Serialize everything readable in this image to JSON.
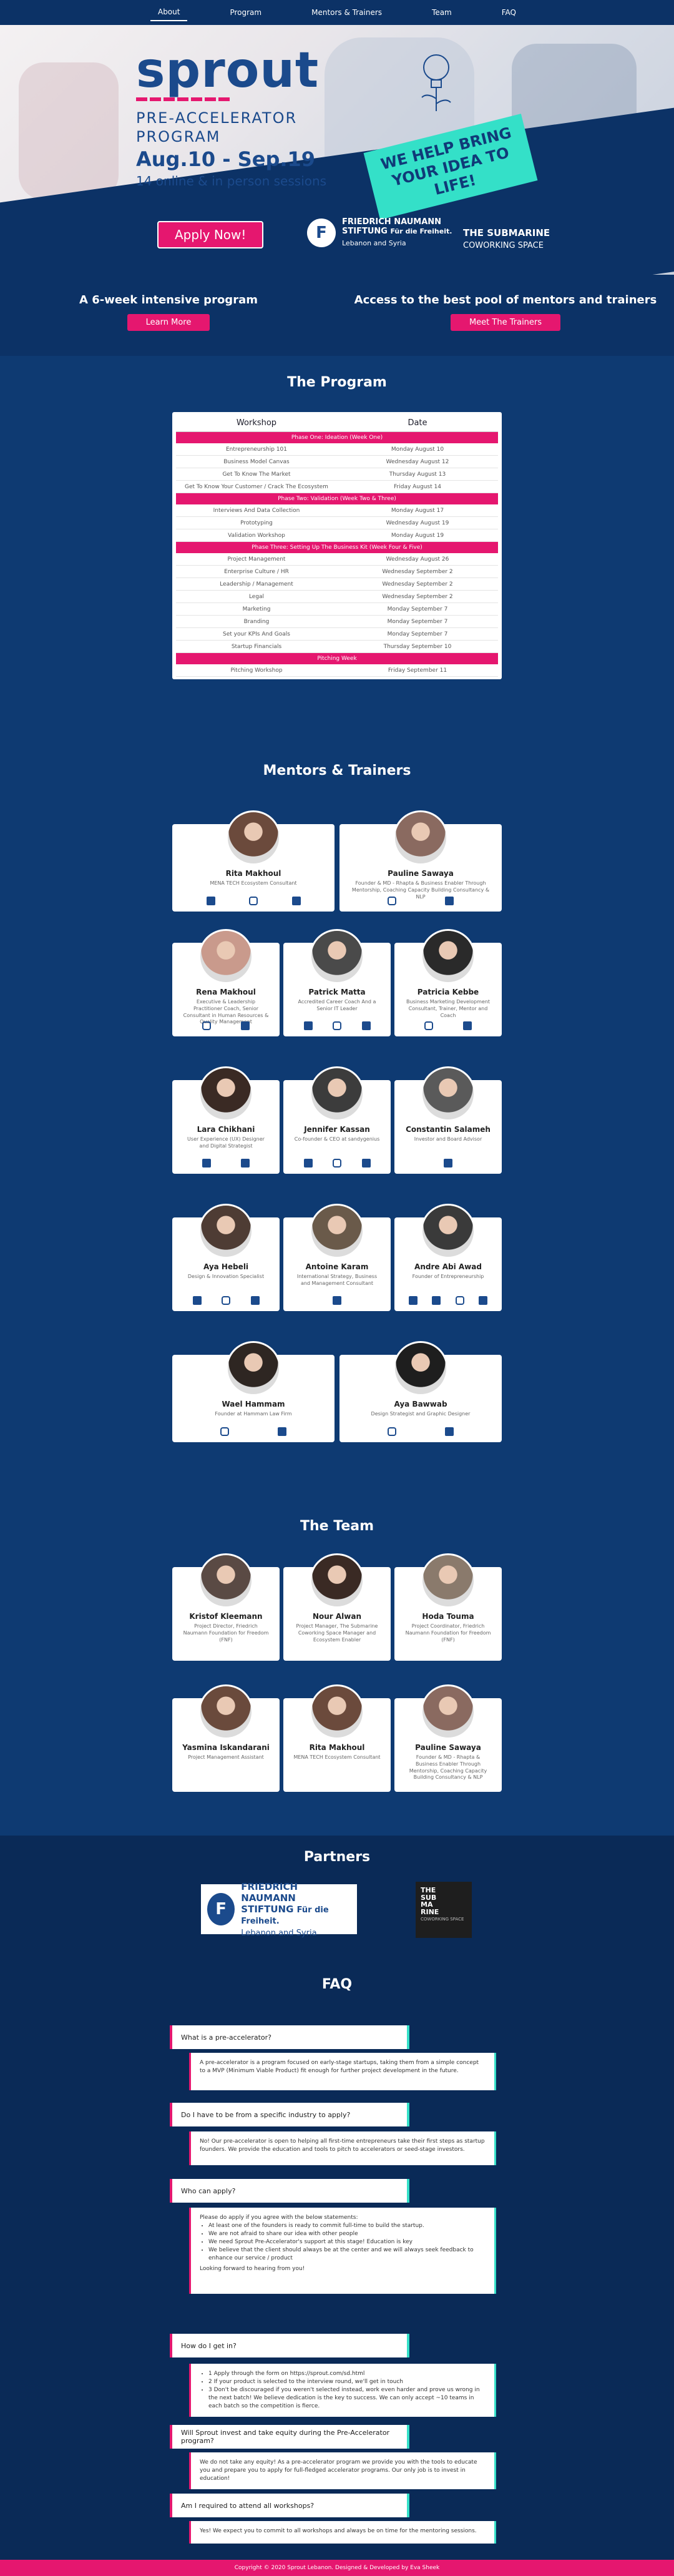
{
  "nav": {
    "items": [
      {
        "label": "About"
      },
      {
        "label": "Program"
      },
      {
        "label": "Mentors & Trainers"
      },
      {
        "label": "Team"
      },
      {
        "label": "FAQ"
      }
    ]
  },
  "hero": {
    "logo_word": "sprout",
    "pre_accelerator": "PRE-ACCELERATOR",
    "program": "PROGRAM",
    "dates": "Aug.10 - Sep.19",
    "sessions": "14 online & in person sessions",
    "apply_label": "Apply Now!",
    "tagline_line1": "WE HELP BRING",
    "tagline_line2": "YOUR IDEA TO LIFE!",
    "fn_name": "FRIEDRICH NAUMANN",
    "fn_name2": "STIFTUNG",
    "fn_sub": "Für die Freiheit.",
    "fn_region": "Lebanon and Syria",
    "sub_name": "THE SUBMARINE",
    "sub_sub": "COWORKING SPACE",
    "colors": {
      "accent": "#e5176f",
      "teal": "#34e0c8",
      "navy": "#0c3266"
    }
  },
  "highlights": [
    {
      "title": "A 6-week intensive program",
      "button": "Learn More"
    },
    {
      "title": "Access to the best pool of mentors and trainers",
      "button": "Meet The Trainers"
    }
  ],
  "program": {
    "title": "The Program",
    "col_workshop": "Workshop",
    "col_date": "Date",
    "rows": [
      {
        "phase": "Phase One: Ideation (Week One)"
      },
      {
        "w": "Entrepreneurship 101",
        "d": "Monday August 10"
      },
      {
        "w": "Business Model Canvas",
        "d": "Wednesday August 12"
      },
      {
        "w": "Get To Know The Market",
        "d": "Thursday August 13"
      },
      {
        "w": "Get To Know Your Customer / Crack The Ecosystem",
        "d": "Friday August 14"
      },
      {
        "phase": "Phase Two: Validation (Week Two & Three)"
      },
      {
        "w": "Interviews And Data Collection",
        "d": "Monday August 17"
      },
      {
        "w": "Prototyping",
        "d": "Wednesday August 19"
      },
      {
        "w": "Validation Workshop",
        "d": "Monday August 19"
      },
      {
        "phase": "Phase Three: Setting Up The Business Kit (Week Four & Five)"
      },
      {
        "w": "Project Management",
        "d": "Wednesday August 26"
      },
      {
        "w": "Enterprise Culture / HR",
        "d": "Wednesday September 2"
      },
      {
        "w": "Leadership / Management",
        "d": "Wednesday September 2"
      },
      {
        "w": "Legal",
        "d": "Wednesday September 2"
      },
      {
        "w": "Marketing",
        "d": "Monday September 7"
      },
      {
        "w": "Branding",
        "d": "Monday September 7"
      },
      {
        "w": "Set your KPIs And Goals",
        "d": "Monday September 7"
      },
      {
        "w": "Startup Financials",
        "d": "Thursday September 10"
      },
      {
        "phase": "Pitching Week"
      },
      {
        "w": "Pitching Workshop",
        "d": "Friday September 11"
      }
    ]
  },
  "mentors": {
    "title": "Mentors & Trainers",
    "people": [
      {
        "name": "Rita Makhoul",
        "role": "MENA TECH Ecosystem Consultant",
        "socials": [
          "twitter",
          "instagram",
          "linkedin"
        ],
        "color": "#6b4a3c"
      },
      {
        "name": "Pauline Sawaya",
        "role": "Founder & MD - Rhapta & Business Enabler Through Mentorship, Coaching Capacity Building Consultancy & NLP",
        "socials": [
          "instagram",
          "linkedin"
        ],
        "color": "#8a6a60"
      },
      {
        "name": "Rena Makhoul",
        "role": "Executive & Leadership Practitioner Coach, Senior Consultant in Human Resources & Quality Management",
        "socials": [
          "instagram",
          "linkedin"
        ],
        "color": "#c99a8c"
      },
      {
        "name": "Patrick Matta",
        "role": "Accredited Career Coach And a Senior IT Leader",
        "socials": [
          "facebook",
          "instagram",
          "linkedin"
        ],
        "color": "#4a4a4a"
      },
      {
        "name": "Patricia Kebbe",
        "role": "Business Marketing Development Consultant, Trainer, Mentor and Coach",
        "socials": [
          "instagram",
          "linkedin"
        ],
        "color": "#2a2a2a"
      },
      {
        "name": "Lara Chikhani",
        "role": "User Experience (UX) Designer and Digital Strategist",
        "socials": [
          "facebook",
          "linkedin"
        ],
        "color": "#3a2a24"
      },
      {
        "name": "Jennifer Kassan",
        "role": "Co-founder & CEO at sandygenius",
        "socials": [
          "facebook",
          "instagram",
          "linkedin"
        ],
        "color": "#3c3c3c"
      },
      {
        "name": "Constantin Salameh",
        "role": "Investor and Board Advisor",
        "socials": [
          "linkedin"
        ],
        "color": "#5a5a5a"
      },
      {
        "name": "Aya Hebeli",
        "role": "Design & Innovation Specialist",
        "socials": [
          "facebook",
          "instagram",
          "linkedin"
        ],
        "color": "#4e3c34"
      },
      {
        "name": "Antoine Karam",
        "role": "International Strategy, Business and Management Consultant",
        "socials": [
          "linkedin"
        ],
        "color": "#6a5a4a"
      },
      {
        "name": "Andre Abi Awad",
        "role": "Founder of Entrepreneurship",
        "socials": [
          "twitter",
          "facebook",
          "instagram",
          "linkedin"
        ],
        "color": "#3a3a3a"
      },
      {
        "name": "Wael Hammam",
        "role": "Founder at Hammam Law Firm",
        "socials": [
          "instagram",
          "linkedin"
        ],
        "color": "#2e2622"
      },
      {
        "name": "Aya Bawwab",
        "role": "Design Strategist and Graphic Designer",
        "socials": [
          "instagram",
          "linkedin"
        ],
        "color": "#1e1e1e"
      }
    ]
  },
  "team": {
    "title": "The Team",
    "people": [
      {
        "name": "Kristof Kleemann",
        "role": "Project Director, Friedrich Naumann Foundation for Freedom (FNF)",
        "color": "#5a4a44"
      },
      {
        "name": "Nour Alwan",
        "role": "Project Manager, The Submarine Coworking Space Manager and Ecosystem Enabler",
        "color": "#3a2a24"
      },
      {
        "name": "Hoda Touma",
        "role": "Project Coordinator, Friedrich Naumann Foundation for Freedom (FNF)",
        "color": "#8a7a6c"
      },
      {
        "name": "Yasmina Iskandarani",
        "role": "Project Management Assistant",
        "color": "#6a4a3c"
      },
      {
        "name": "Rita Makhoul",
        "role": "MENA TECH Ecosystem Consultant",
        "color": "#6b4a3c"
      },
      {
        "name": "Pauline Sawaya",
        "role": "Founder & MD - Rhapta & Business Enabler Through Mentorship, Coaching Capacity Building Consultancy & NLP",
        "color": "#8a6a60"
      }
    ]
  },
  "partners": {
    "title": "Partners",
    "fn_name": "FRIEDRICH NAUMANN",
    "fn_name2": "STIFTUNG",
    "fn_sub": "Für die Freiheit.",
    "fn_region": "Lebanon and Syria",
    "sub_lines": [
      "THE",
      "SUB",
      "MA",
      "RINE"
    ],
    "sub_tag": "COWORKING SPACE"
  },
  "faq": {
    "title": "FAQ",
    "items": [
      {
        "q": "What is a pre-accelerator?",
        "a": "A pre-accelerator is a program focused on early-stage startups, taking them from a simple concept to a MVP (Minimum Viable Product) fit enough for further project development in the future."
      },
      {
        "q": "Do I have to be from a specific industry to apply?",
        "a": "No! Our pre-accelerator is open to helping all first-time entrepreneurs take their first steps as startup founders. We provide the education and tools to pitch to accelerators or seed-stage investors."
      },
      {
        "q": "Who can apply?",
        "a_intro": "Please do apply if you agree with the below statements:",
        "bullets": [
          "At least one of the founders is ready to commit full-time to build the startup.",
          "We are not afraid to share our idea with other people",
          "We need Sprout Pre-Accelerator's support at this stage! Education is key",
          "We believe that the client should always be at the center and we will always seek feedback to enhance our service / product"
        ],
        "a_outro": "Looking forward to hearing from you!"
      },
      {
        "q": "How do I get in?",
        "bullets": [
          "1 Apply through the form on https://sprout.com/sd.html",
          "2 If your product is selected to the interview round, we'll get in touch",
          "3 Don't be discouraged if you weren't selected instead, work even harder and prove us wrong in the next batch! We believe dedication is the key to success. We can only accept ~10 teams in each batch so the competition is fierce."
        ]
      },
      {
        "q": "Will Sprout invest and take equity during the Pre-Accelerator program?",
        "a": "We do not take any equity! As a pre-accelerator program we provide you with the tools to educate you and prepare you to apply for full-fledged accelerator programs. Our only job is to invest in education!"
      },
      {
        "q": "Am I required to attend all workshops?",
        "a": "Yes! We expect you to commit to all workshops and always be on time for the mentoring sessions."
      }
    ]
  },
  "footer": {
    "text": "Copyright © 2020 Sprout Lebanon. Designed & Developed by Eva Sheek"
  }
}
